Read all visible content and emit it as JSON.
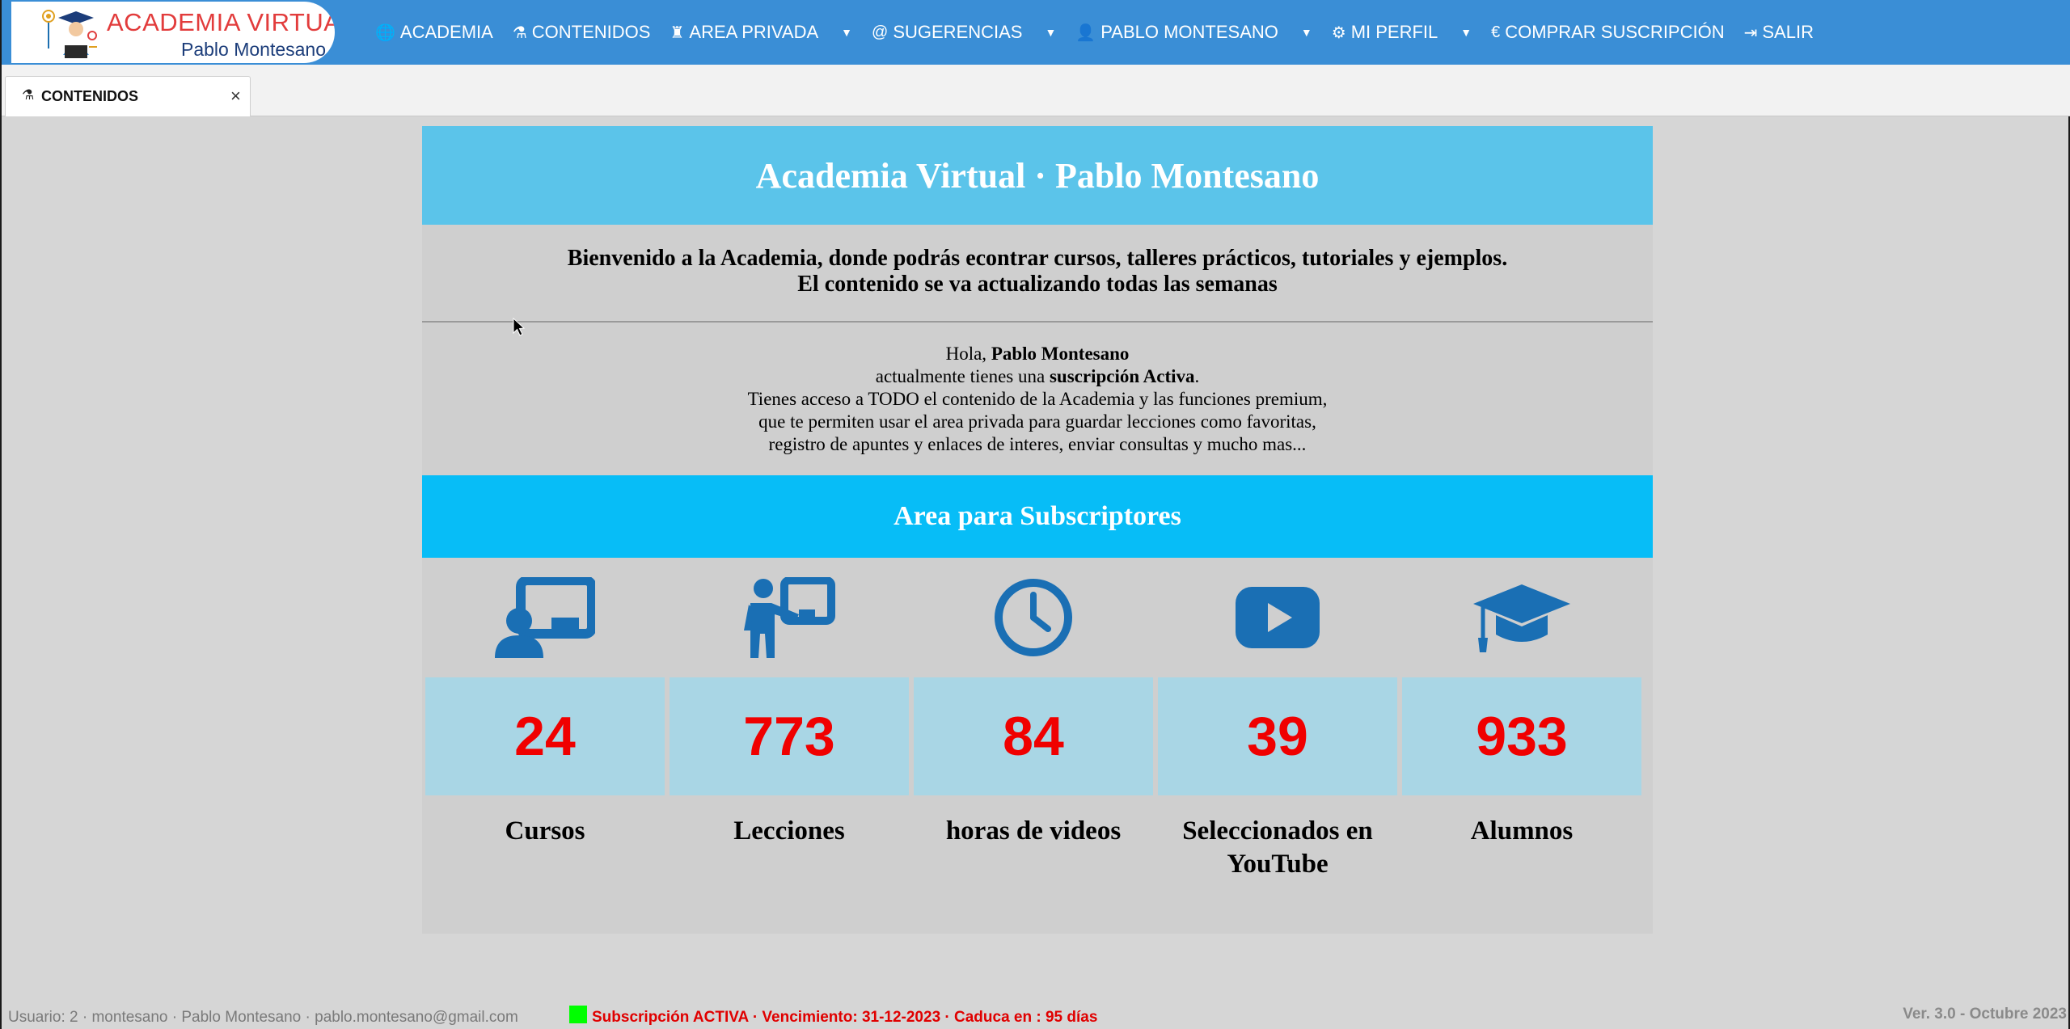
{
  "logo": {
    "title": "ACADEMIA VIRTUAL",
    "subtitle": "Pablo Montesano"
  },
  "nav": {
    "items": [
      {
        "label": "ACADEMIA",
        "icon": "globe-icon",
        "dropdown": false
      },
      {
        "label": "CONTENIDOS",
        "icon": "flask-icon",
        "dropdown": false
      },
      {
        "label": "AREA PRIVADA",
        "icon": "user-lock-icon",
        "dropdown": true
      },
      {
        "label": "SUGERENCIAS",
        "icon": "at-icon",
        "dropdown": true
      },
      {
        "label": "PABLO MONTESANO",
        "icon": "user-icon",
        "dropdown": true
      },
      {
        "label": "MI PERFIL",
        "icon": "gears-icon",
        "dropdown": true
      },
      {
        "label": "COMPRAR SUSCRIPCIÓN",
        "icon": "euro-icon",
        "dropdown": false
      },
      {
        "label": "SALIR",
        "icon": "sign-out-icon",
        "dropdown": false
      }
    ]
  },
  "tab": {
    "label": "CONTENIDOS",
    "icon": "flask-icon",
    "close": "×"
  },
  "hero": {
    "title": "Academia Virtual · Pablo Montesano"
  },
  "welcome": {
    "line1": "Bienvenido a la Academia, donde podrás econtrar cursos, talleres prácticos, tutoriales y ejemplos.",
    "line2": "El contenido se va actualizando todas las semanas"
  },
  "greeting": {
    "hello": "Hola, ",
    "name": "Pablo Montesano",
    "status_pre": "actualmente tienes una ",
    "status": "suscripción Activa",
    "status_post": ".",
    "line3": "Tienes acceso a TODO el contenido de la Academia y las funciones premium,",
    "line4": "que te permiten usar el area privada para guardar lecciones como favoritas,",
    "line5": "registro de apuntes y enlaces de interes, enviar consultas y mucho mas..."
  },
  "subscribers": {
    "title": "Area para Subscriptores"
  },
  "stats": [
    {
      "value": "24",
      "label": "Cursos",
      "icon": "chalkboard-user-icon"
    },
    {
      "value": "773",
      "label": "Lecciones",
      "icon": "chalkboard-teacher-icon"
    },
    {
      "value": "84",
      "label": "horas de videos",
      "icon": "clock-icon"
    },
    {
      "value": "39",
      "label": "Seleccionados en YouTube",
      "icon": "youtube-icon"
    },
    {
      "value": "933",
      "label": "Alumnos",
      "icon": "graduation-cap-icon"
    }
  ],
  "footer": {
    "user": "Usuario: 2 · montesano · Pablo Montesano · pablo.montesano@gmail.com",
    "subscription": "Subscripción ACTIVA · Vencimiento: 31-12-2023 · Caduca en : 95 días",
    "version": "Ver. 3.0 - Octubre 2023"
  },
  "colors": {
    "nav_bg": "#3a8ed6",
    "hero_bg": "#5bc4ea",
    "band_bg": "#07bdf7",
    "stat_box": "#a9d6e5",
    "stat_num": "#f00000",
    "icon": "#1a6fb4",
    "status_ok": "#00ff00"
  }
}
